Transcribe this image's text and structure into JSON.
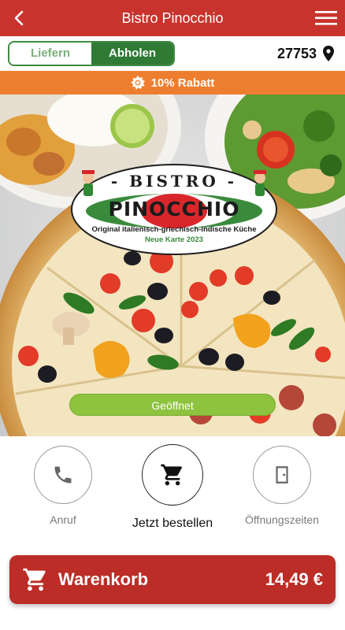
{
  "header": {
    "title": "Bistro Pinocchio",
    "back_icon": "chevron-left-icon",
    "menu_icon": "hamburger-menu-icon"
  },
  "order_mode": {
    "options": [
      "Liefern",
      "Abholen"
    ],
    "selected": "Abholen"
  },
  "location": {
    "zip": "27753",
    "icon": "location-pin-icon"
  },
  "discount": {
    "label": "10% Rabatt",
    "icon": "badge-icon"
  },
  "hero": {
    "logo_line1": "- BISTRO -",
    "logo_line2": "PINOCCHIO",
    "logo_subtitle": "Original italienisch-griechisch-indische Küche",
    "logo_menu_note": "Neue Karte 2023",
    "status": "Geöffnet"
  },
  "actions": [
    {
      "label": "Anruf",
      "icon": "phone-icon"
    },
    {
      "label": "Jetzt bestellen",
      "icon": "cart-icon"
    },
    {
      "label": "Öffnungszeiten",
      "icon": "door-icon"
    }
  ],
  "cart": {
    "label": "Warenkorb",
    "total": "14,49 €",
    "icon": "cart-icon"
  },
  "colors": {
    "brand_red": "#c8342d",
    "toggle_green": "#2f7a35",
    "discount_orange": "#ee7e2f",
    "open_green": "#8dc33e"
  }
}
